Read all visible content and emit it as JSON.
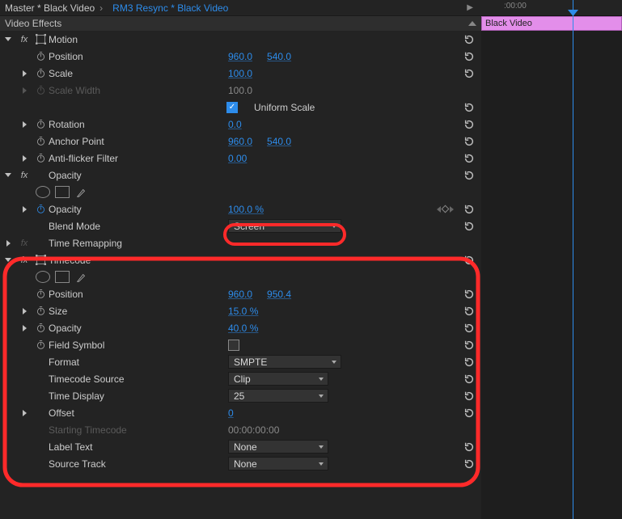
{
  "breadcrumb": {
    "master": "Master * Black Video",
    "clip": "RM3 Resync * Black Video"
  },
  "section": "Video Effects",
  "timeline": {
    "time0": ":00:00",
    "clip_name": "Black Video"
  },
  "fx": {
    "motion": {
      "name": "Motion",
      "position": {
        "label": "Position",
        "x": "960.0",
        "y": "540.0"
      },
      "scale": {
        "label": "Scale",
        "v": "100.0"
      },
      "scale_w": {
        "label": "Scale Width",
        "v": "100.0"
      },
      "uniform": {
        "label": "Uniform Scale"
      },
      "rotation": {
        "label": "Rotation",
        "v": "0.0"
      },
      "anchor": {
        "label": "Anchor Point",
        "x": "960.0",
        "y": "540.0"
      },
      "antiflicker": {
        "label": "Anti-flicker Filter",
        "v": "0.00"
      }
    },
    "opacity": {
      "name": "Opacity",
      "opacity": {
        "label": "Opacity",
        "v": "100.0 %"
      },
      "blend": {
        "label": "Blend Mode",
        "v": "Screen"
      }
    },
    "time_remap": {
      "name": "Time Remapping"
    },
    "timecode": {
      "name": "Timecode",
      "position": {
        "label": "Position",
        "x": "960.0",
        "y": "950.4"
      },
      "size": {
        "label": "Size",
        "v": "15.0 %"
      },
      "opacity": {
        "label": "Opacity",
        "v": "40.0 %"
      },
      "field": {
        "label": "Field Symbol"
      },
      "format": {
        "label": "Format",
        "v": "SMPTE"
      },
      "source": {
        "label": "Timecode Source",
        "v": "Clip"
      },
      "display": {
        "label": "Time Display",
        "v": "25"
      },
      "offset": {
        "label": "Offset",
        "v": "0"
      },
      "start": {
        "label": "Starting Timecode",
        "v": "00:00:00:00"
      },
      "labeltxt": {
        "label": "Label Text",
        "v": "None"
      },
      "track": {
        "label": "Source Track",
        "v": "None"
      }
    }
  }
}
